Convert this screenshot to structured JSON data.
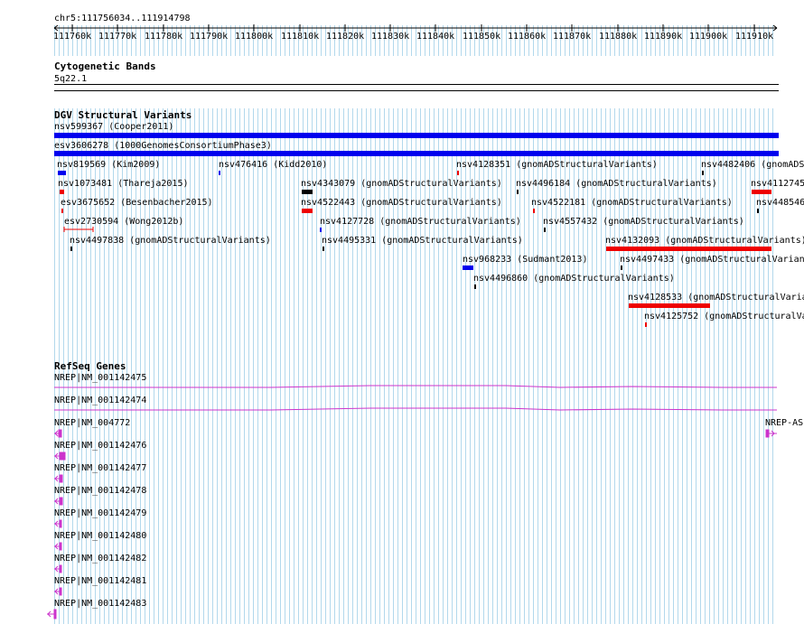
{
  "position": "chr5:111756034..111914798",
  "ruler": {
    "ticks": [
      "111760k",
      "111770k",
      "111780k",
      "111790k",
      "111800k",
      "111810k",
      "111820k",
      "111830k",
      "111840k",
      "111850k",
      "111860k",
      "111870k",
      "111880k",
      "111890k",
      "111900k",
      "111910k"
    ]
  },
  "cytobands": {
    "title": "Cytogenetic Bands",
    "band": "5q22.1"
  },
  "dgv": {
    "title": "DGV Structural Variants",
    "features": [
      {
        "label": "nsv599367 (Cooper2011)",
        "color": "#0000ee"
      },
      {
        "label": "esv3606278 (1000GenomesConsortiumPhase3)",
        "color": "#0000ee"
      },
      {
        "label": "nsv819569 (Kim2009)",
        "color": "#0000ee"
      },
      {
        "label": "nsv476416 (Kidd2010)",
        "color": "#0000ee"
      },
      {
        "label": "nsv4128351 (gnomADStructuralVariants)",
        "color": "#ee0000"
      },
      {
        "label": "nsv4482406 (gnomADS",
        "color": "#000000"
      },
      {
        "label": "nsv1073481 (Thareja2015)",
        "color": "#ee0000"
      },
      {
        "label": "nsv4343079 (gnomADStructuralVariants)",
        "color": "#000000"
      },
      {
        "label": "nsv4496184 (gnomADStructuralVariants)",
        "color": "#000000"
      },
      {
        "label": "nsv4112745",
        "color": "#ee0000"
      },
      {
        "label": "esv3675652 (Besenbacher2015)",
        "color": "#ee0000"
      },
      {
        "label": "nsv4522443 (gnomADStructuralVariants)",
        "color": "#ee0000"
      },
      {
        "label": "nsv4522181 (gnomADStructuralVariants)",
        "color": "#ee0000"
      },
      {
        "label": "nsv448546",
        "color": "#000000"
      },
      {
        "label": "esv2730594 (Wong2012b)",
        "color": "#ee0000"
      },
      {
        "label": "nsv4127728 (gnomADStructuralVariants)",
        "color": "#0000ee"
      },
      {
        "label": "nsv4557432 (gnomADStructuralVariants)",
        "color": "#000000"
      },
      {
        "label": "nsv4497838 (gnomADStructuralVariants)",
        "color": "#000000"
      },
      {
        "label": "nsv4495331 (gnomADStructuralVariants)",
        "color": "#000000"
      },
      {
        "label": "nsv4132093 (gnomADStructuralVariants)",
        "color": "#ee0000"
      },
      {
        "label": "nsv968233 (Sudmant2013)",
        "color": "#0000ee"
      },
      {
        "label": "nsv4497433 (gnomADStructuralVarian",
        "color": "#000000"
      },
      {
        "label": "nsv4496860 (gnomADStructuralVariants)",
        "color": "#000000"
      },
      {
        "label": "nsv4128533 (gnomADStructuralVaria",
        "color": "#ee0000"
      },
      {
        "label": "nsv4125752 (gnomADStructuralVa",
        "color": "#ee0000"
      }
    ]
  },
  "refseq": {
    "title": "RefSeq Genes",
    "genes": [
      {
        "label": "NREP|NM_001142475",
        "color": "#cc33cc"
      },
      {
        "label": "NREP|NM_001142474",
        "color": "#cc33cc"
      },
      {
        "label": "NREP|NM_004772",
        "color": "#cc33cc"
      },
      {
        "label": "NREP-AS",
        "color": "#cc33cc"
      },
      {
        "label": "NREP|NM_001142476",
        "color": "#cc33cc"
      },
      {
        "label": "NREP|NM_001142477",
        "color": "#cc33cc"
      },
      {
        "label": "NREP|NM_001142478",
        "color": "#cc33cc"
      },
      {
        "label": "NREP|NM_001142479",
        "color": "#cc33cc"
      },
      {
        "label": "NREP|NM_001142480",
        "color": "#cc33cc"
      },
      {
        "label": "NREP|NM_001142482",
        "color": "#cc33cc"
      },
      {
        "label": "NREP|NM_001142481",
        "color": "#cc33cc"
      },
      {
        "label": "NREP|NM_001142483",
        "color": "#cc33cc"
      }
    ]
  }
}
